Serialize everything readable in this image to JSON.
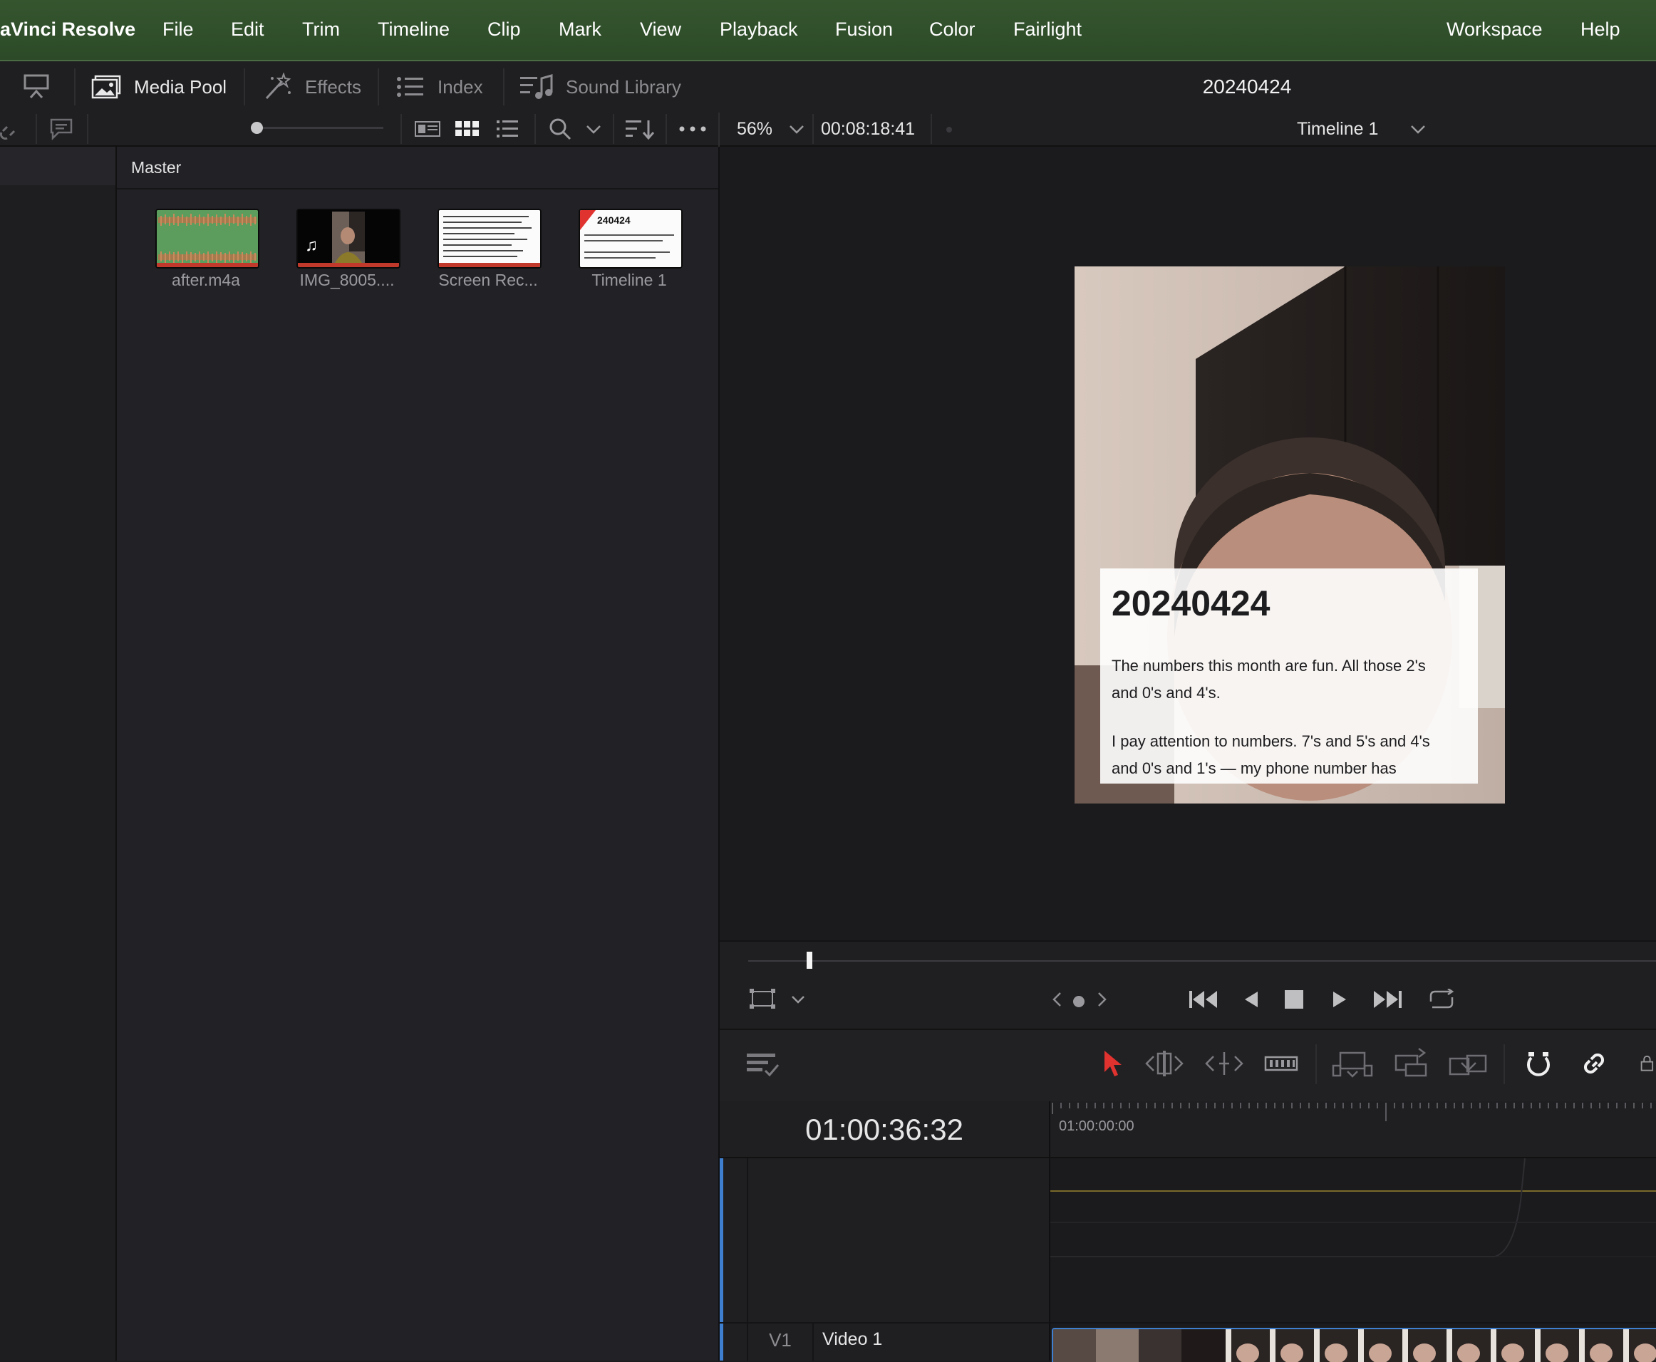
{
  "menubar": {
    "app_name": "aVinci Resolve",
    "items": [
      "File",
      "Edit",
      "Trim",
      "Timeline",
      "Clip",
      "Mark",
      "View",
      "Playback",
      "Fusion",
      "Color",
      "Fairlight"
    ],
    "right_items": [
      "Workspace",
      "Help"
    ]
  },
  "toolbar": {
    "media_pool": "Media Pool",
    "effects": "Effects",
    "index": "Index",
    "sound_library": "Sound Library",
    "project_title": "20240424"
  },
  "viewer_bar": {
    "zoom": "56%",
    "timecode": "00:08:18:41",
    "timeline_name": "Timeline 1"
  },
  "media_pool": {
    "bin_name": "Master",
    "clips": [
      {
        "label": "after.m4a",
        "kind": "audio"
      },
      {
        "label": "IMG_8005....",
        "kind": "video"
      },
      {
        "label": "Screen Rec...",
        "kind": "screen"
      },
      {
        "label": "Timeline 1",
        "kind": "timeline",
        "thumb_text": "240424"
      }
    ]
  },
  "viewer": {
    "overlay_title": "20240424",
    "overlay_p1_line1": "The numbers this month are fun. All those 2's",
    "overlay_p1_line2": "and 0's and 4's.",
    "overlay_p2_line1": "I pay attention to numbers. 7's and 5's and 4's",
    "overlay_p2_line2": "and 0's and 1's — my phone number has",
    "playhead_position": 0.06
  },
  "timeline": {
    "current_timecode": "01:00:36:32",
    "ruler_start": "01:00:00:00",
    "track_id": "V1",
    "track_name": "Video 1"
  },
  "colors": {
    "menubar": "#2f4e2a",
    "accent_red": "#e0322f",
    "track_blue": "#3f7fd0",
    "audio_green": "#5a9b5a"
  }
}
